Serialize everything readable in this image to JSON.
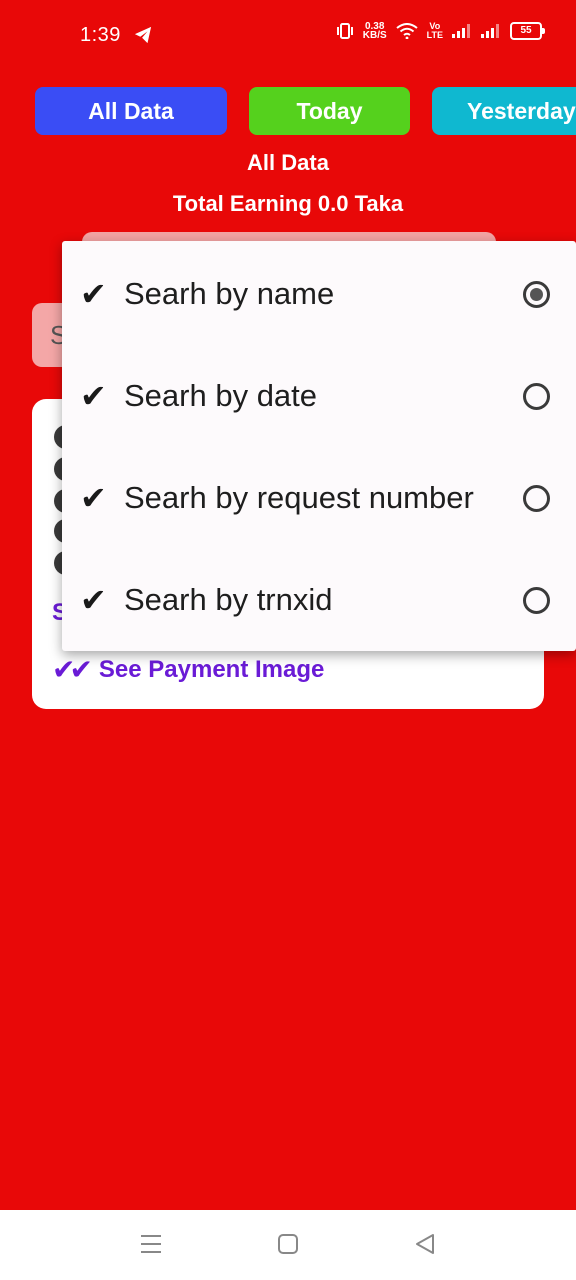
{
  "status_bar": {
    "time": "1:39",
    "net_speed_value": "0.38",
    "net_speed_unit": "KB/S",
    "volte_top": "Vo",
    "volte_bottom": "LTE",
    "battery": "55"
  },
  "filters": {
    "all": "All Data",
    "today": "Today",
    "yesterday": "Yesterday"
  },
  "header": {
    "section_title": "All Data",
    "total_earning": "Total Earning 0.0 Taka"
  },
  "search": {
    "partial_text": "S"
  },
  "card": {
    "partial_link": "S",
    "payment_link": "See Payment Image"
  },
  "popup": {
    "options": [
      {
        "label": "Searh by name",
        "selected": true
      },
      {
        "label": "Searh by date",
        "selected": false
      },
      {
        "label": "Searh by request number",
        "selected": false
      },
      {
        "label": "Searh by trnxid",
        "selected": false
      }
    ]
  },
  "colors": {
    "background": "#e80808",
    "all_button": "#3a4df5",
    "today_button": "#55d11d",
    "yesterday_button": "#0fb8d0",
    "link": "#6a1bd6"
  }
}
